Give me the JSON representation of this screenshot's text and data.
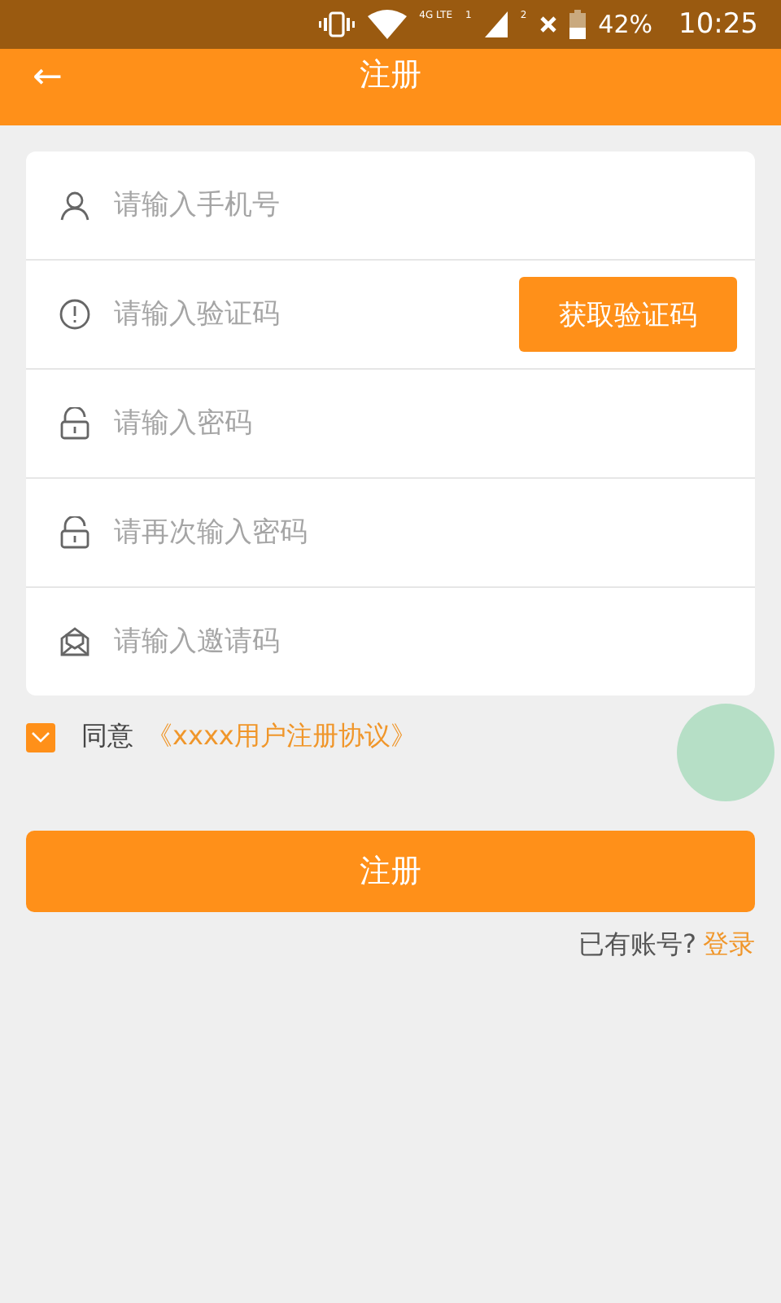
{
  "status_bar": {
    "network": "4G LTE",
    "sim_1": "1",
    "sim_2": "2",
    "battery": "42%",
    "time": "10:25"
  },
  "header": {
    "back": "←",
    "title": "注册"
  },
  "fields": [
    {
      "kind": "person",
      "placeholder": "请输入手机号"
    },
    {
      "kind": "alert",
      "placeholder": "请输入验证码",
      "button": "获取验证码"
    },
    {
      "kind": "lock",
      "placeholder": "请输入密码"
    },
    {
      "kind": "lock",
      "placeholder": "请再次输入密码"
    },
    {
      "kind": "invite",
      "placeholder": "请输入邀请码"
    }
  ],
  "agreement": {
    "checked": true,
    "label": "同意",
    "link": "《xxxx用户注册协议》"
  },
  "submit": "注册",
  "login_prompt": {
    "text": "已有账号?",
    "link": "登录"
  }
}
